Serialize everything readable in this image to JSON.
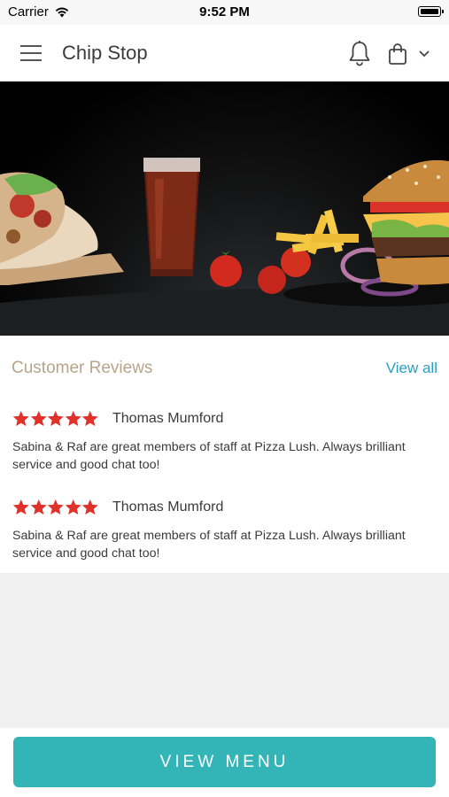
{
  "status_bar": {
    "carrier": "Carrier",
    "time": "9:52 PM"
  },
  "header": {
    "title": "Chip Stop",
    "icons": [
      "menu-icon",
      "bell-icon",
      "shopping-bag-icon",
      "chevron-down-icon"
    ]
  },
  "hero": {
    "image_description_icon": "food-hero-image"
  },
  "reviews": {
    "title": "Customer Reviews",
    "view_all_label": "View all",
    "items": [
      {
        "rating": 5,
        "name": "Thomas Mumford",
        "text": "Sabina & Raf are great members of staff at Pizza Lush. Always brilliant service and good chat too!"
      },
      {
        "rating": 5,
        "name": "Thomas Mumford",
        "text": "Sabina & Raf are great members of staff at Pizza Lush. Always brilliant service and good chat too!"
      }
    ]
  },
  "footer": {
    "view_menu_label": "VIEW MENU"
  },
  "colors": {
    "accent": "#33b4b6",
    "link": "#2c9fbe",
    "star": "#e0312b",
    "section_title": "#b5a58a"
  }
}
